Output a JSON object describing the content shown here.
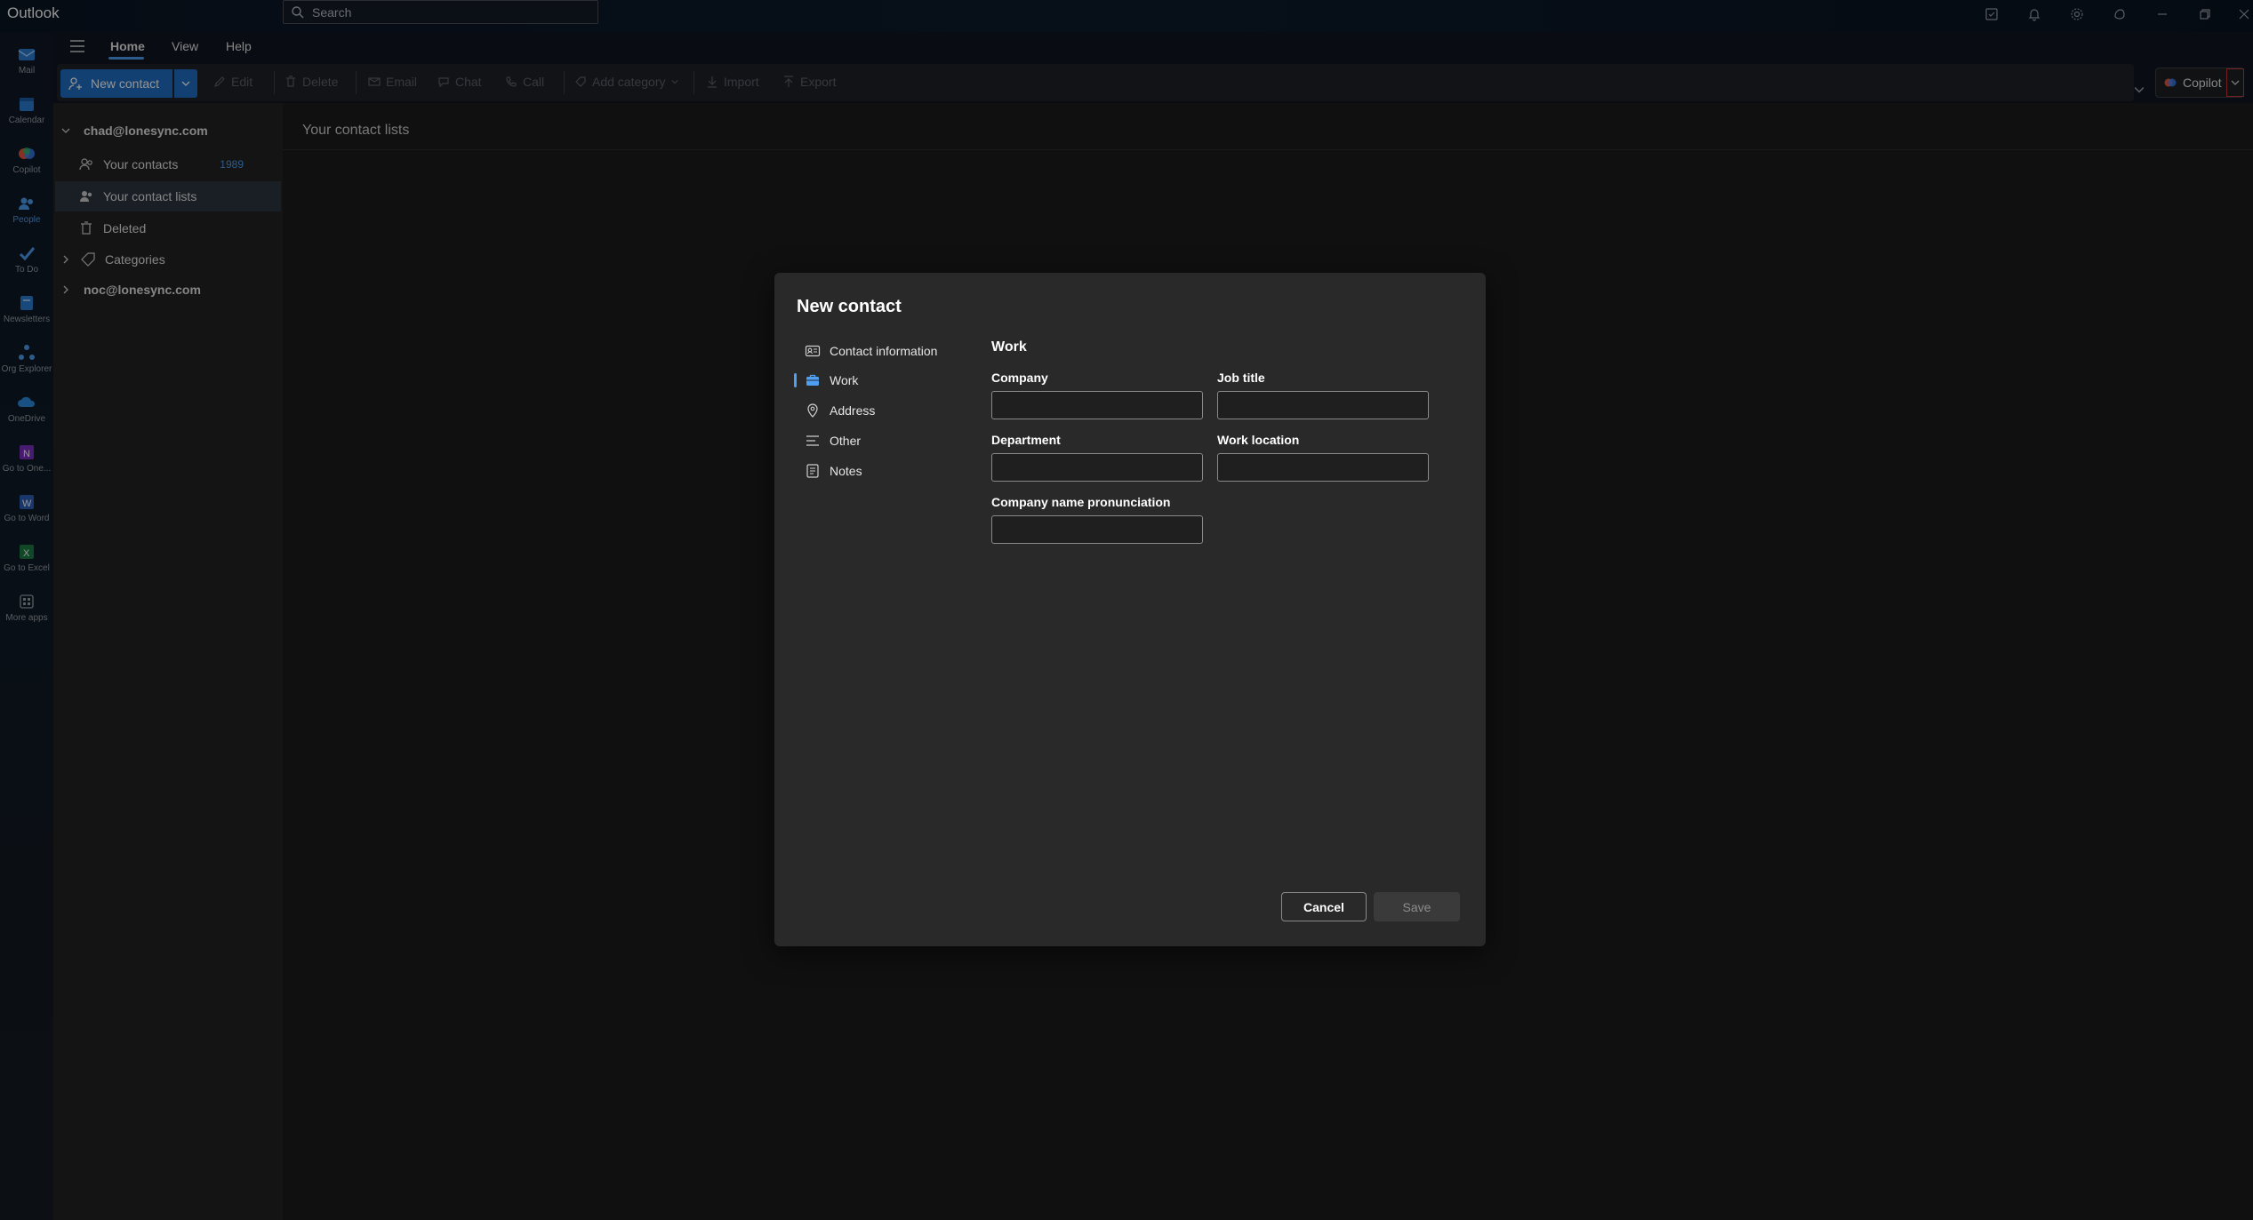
{
  "titlebar": {
    "app_name": "Outlook",
    "search_placeholder": "Search"
  },
  "rail": {
    "items": [
      {
        "label": "Mail",
        "icon": "mail-icon"
      },
      {
        "label": "Calendar",
        "icon": "calendar-icon"
      },
      {
        "label": "Copilot",
        "icon": "copilot-icon"
      },
      {
        "label": "People",
        "icon": "people-icon"
      },
      {
        "label": "To Do",
        "icon": "todo-icon"
      },
      {
        "label": "Newsletters",
        "icon": "newsletter-icon"
      },
      {
        "label": "Org Explorer",
        "icon": "org-explorer-icon"
      },
      {
        "label": "OneDrive",
        "icon": "onedrive-icon"
      },
      {
        "label": "Go to One...",
        "icon": "onenote-icon"
      },
      {
        "label": "Go to Word",
        "icon": "word-icon"
      },
      {
        "label": "Go to Excel",
        "icon": "excel-icon"
      },
      {
        "label": "More apps",
        "icon": "apps-icon"
      }
    ]
  },
  "ribbon": {
    "tabs": [
      "Home",
      "View",
      "Help"
    ],
    "new_contact": "New contact",
    "edit": "Edit",
    "delete": "Delete",
    "email": "Email",
    "chat": "Chat",
    "call": "Call",
    "add_category": "Add category",
    "import": "Import",
    "export": "Export",
    "copilot": "Copilot"
  },
  "folders": {
    "account1": "chad@lonesync.com",
    "your_contacts": "Your contacts",
    "your_contacts_count": "1989",
    "your_contact_lists": "Your contact lists",
    "deleted": "Deleted",
    "categories": "Categories",
    "account2": "noc@lonesync.com"
  },
  "main": {
    "title": "Your contact lists"
  },
  "dialog": {
    "title": "New contact",
    "nav": [
      "Contact information",
      "Work",
      "Address",
      "Other",
      "Notes"
    ],
    "active_nav": "Work",
    "section_title": "Work",
    "fields": {
      "company": {
        "label": "Company",
        "value": ""
      },
      "job_title": {
        "label": "Job title",
        "value": ""
      },
      "department": {
        "label": "Department",
        "value": ""
      },
      "work_location": {
        "label": "Work location",
        "value": ""
      },
      "company_pronunciation": {
        "label": "Company name pronunciation",
        "value": ""
      }
    },
    "cancel": "Cancel",
    "save": "Save"
  },
  "colors": {
    "accent": "#1f6fc5",
    "accent_light": "#4f9ef0",
    "dialog_bg": "#292929"
  }
}
